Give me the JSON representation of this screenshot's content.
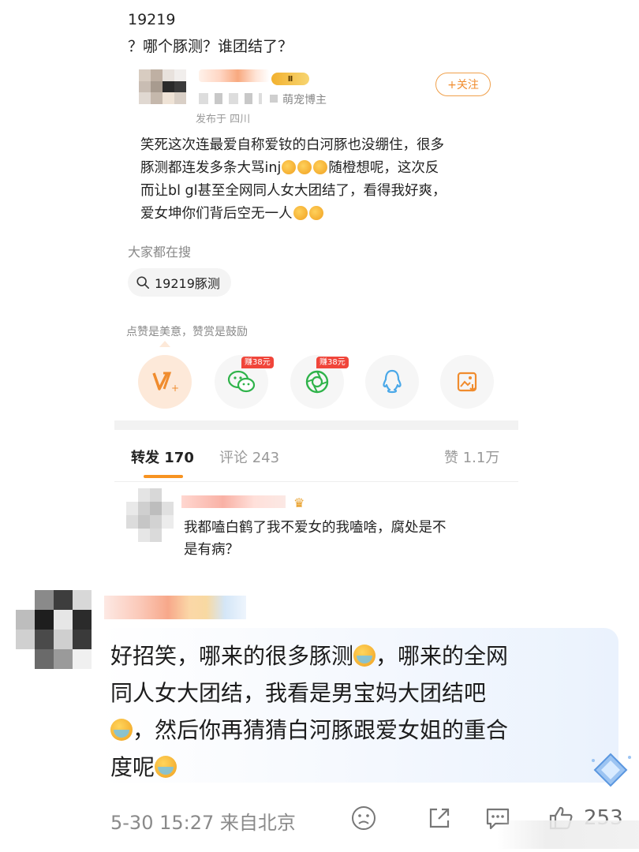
{
  "post": {
    "title": "19219",
    "subtitle": "？哪个豚测？谁团结了？",
    "author_badge": "Ⅱ",
    "author_tag": "萌宠博主",
    "publish_location": "发布于 四川",
    "follow_label": "+关注",
    "body_line1": "笑死这次连最爱自称爱钕的白河豚也没绷住，很多",
    "body_line2a": "豚测都连发多条大骂inj",
    "body_line2b": "随橙想呢，这次反",
    "body_line3": "而让bl gl甚至全网同人女大团结了，看得我好爽，",
    "body_line4": "爱女坤你们背后空无一人"
  },
  "search": {
    "label": "大家都在搜",
    "chip": "19219豚测"
  },
  "reward": {
    "hint": "点赞是美意，赞赏是鼓励",
    "wechat_tag": "赚38元",
    "moments_tag": "赚38元"
  },
  "tabs": {
    "repost": "转发 170",
    "comment": "评论 243",
    "like": "赞 1.1万"
  },
  "repost_item": {
    "line1": "我都嗑白鹤了我不爱女的我嗑啥，腐处是不",
    "line2": "是有病？"
  },
  "comment": {
    "seg1": "好招笑，哪来的很多豚测",
    "seg2": "，哪来的全网",
    "line2": "同人女大团结，我看是男宝妈大团结吧",
    "seg3": "，然后你再猜猜白河豚跟爱女姐的重合",
    "seg4": "度呢",
    "time_location": "5-30 15:27  来自北京",
    "like_count": "253"
  },
  "colors": {
    "accent_orange": "#f79321",
    "follow_orange": "#f08c2e",
    "reward_red": "#f0453a",
    "wechat_green": "#2fb34a",
    "qq_blue": "#4aa8e8"
  },
  "icons": [
    "search-icon",
    "vip-icon",
    "wechat-icon",
    "moments-icon",
    "qq-icon",
    "save-image-icon",
    "crown-icon",
    "emoji-icon",
    "share-icon",
    "comment-icon",
    "thumb-up-icon",
    "diamond-icon"
  ]
}
